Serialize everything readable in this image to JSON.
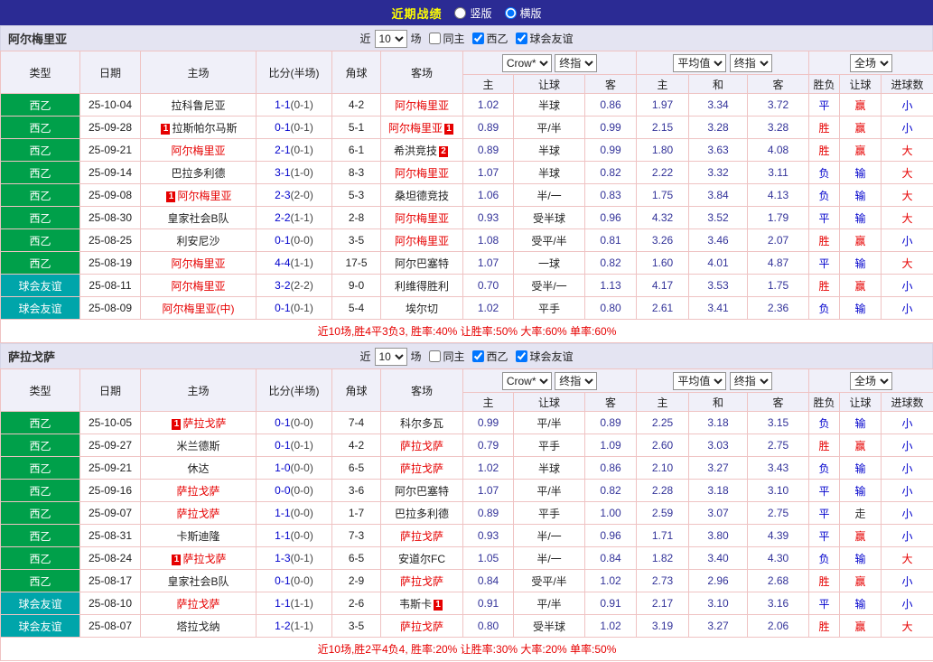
{
  "topbar": {
    "title": "近期战绩",
    "vertical_label": "竖版",
    "horizontal_label": "横版",
    "selected": "横版"
  },
  "filter": {
    "near": "近",
    "count": "10",
    "matches": "场",
    "same_home": "同主",
    "league": "西乙",
    "friendly": "球会友谊",
    "same_home_checked": false,
    "league_checked": true,
    "friendly_checked": true
  },
  "header": {
    "type": "类型",
    "date": "日期",
    "home": "主场",
    "score": "比分(半场)",
    "corner": "角球",
    "away": "客场",
    "odds_source": "Crow*",
    "final1": "终指",
    "average": "平均值",
    "final2": "终指",
    "full": "全场",
    "sub": [
      "主",
      "让球",
      "客",
      "主",
      "和",
      "客",
      "胜负",
      "让球",
      "进球数"
    ]
  },
  "colors": {
    "win": "#E60000",
    "lose": "#0000CC",
    "draw": "#0000CC",
    "walk": "#333333",
    "highlight": "#E60000",
    "league_green": "#00A04A",
    "friendly_teal": "#00A5AA",
    "topbar_bg": "#2B2B94",
    "title_yellow": "#FFFF00",
    "border_pink": "#EFC3C3"
  },
  "sections": [
    {
      "team": "阿尔梅里亚",
      "summary": "近10场,胜4平3负3, 胜率:40% 让胜率:50% 大率:60% 单率:60%",
      "rows": [
        {
          "type": "西乙",
          "kind": "league",
          "date": "25-10-04",
          "home": {
            "name": "拉科鲁尼亚"
          },
          "ft": "1-1",
          "ht": "(0-1)",
          "corner": "4-2",
          "away": {
            "name": "阿尔梅里亚",
            "red": true
          },
          "odds": [
            "1.02",
            "半球",
            "0.86"
          ],
          "avg": [
            "1.97",
            "3.34",
            "3.72"
          ],
          "result": "平",
          "let": "赢",
          "goal": "小"
        },
        {
          "type": "西乙",
          "kind": "league",
          "date": "25-09-28",
          "home": {
            "name": "拉斯帕尔马斯",
            "b1": "1"
          },
          "ft": "0-1",
          "ht": "(0-1)",
          "corner": "5-1",
          "away": {
            "name": "阿尔梅里亚",
            "red": true,
            "b2": "1"
          },
          "odds": [
            "0.89",
            "平/半",
            "0.99"
          ],
          "avg": [
            "2.15",
            "3.28",
            "3.28"
          ],
          "result": "胜",
          "let": "赢",
          "goal": "小"
        },
        {
          "type": "西乙",
          "kind": "league",
          "date": "25-09-21",
          "home": {
            "name": "阿尔梅里亚",
            "red": true
          },
          "ft": "2-1",
          "ht": "(0-1)",
          "corner": "6-1",
          "away": {
            "name": "希洪竞技",
            "b2": "2"
          },
          "odds": [
            "0.89",
            "半球",
            "0.99"
          ],
          "avg": [
            "1.80",
            "3.63",
            "4.08"
          ],
          "result": "胜",
          "let": "赢",
          "goal": "大"
        },
        {
          "type": "西乙",
          "kind": "league",
          "date": "25-09-14",
          "home": {
            "name": "巴拉多利德"
          },
          "ft": "3-1",
          "ht": "(1-0)",
          "corner": "8-3",
          "away": {
            "name": "阿尔梅里亚",
            "red": true
          },
          "odds": [
            "1.07",
            "半球",
            "0.82"
          ],
          "avg": [
            "2.22",
            "3.32",
            "3.11"
          ],
          "result": "负",
          "let": "输",
          "goal": "大"
        },
        {
          "type": "西乙",
          "kind": "league",
          "date": "25-09-08",
          "home": {
            "name": "阿尔梅里亚",
            "red": true,
            "b1": "1"
          },
          "ft": "2-3",
          "ht": "(2-0)",
          "corner": "5-3",
          "away": {
            "name": "桑坦德竞技"
          },
          "odds": [
            "1.06",
            "半/一",
            "0.83"
          ],
          "avg": [
            "1.75",
            "3.84",
            "4.13"
          ],
          "result": "负",
          "let": "输",
          "goal": "大"
        },
        {
          "type": "西乙",
          "kind": "league",
          "date": "25-08-30",
          "home": {
            "name": "皇家社会B队"
          },
          "ft": "2-2",
          "ht": "(1-1)",
          "corner": "2-8",
          "away": {
            "name": "阿尔梅里亚",
            "red": true
          },
          "odds": [
            "0.93",
            "受半球",
            "0.96"
          ],
          "avg": [
            "4.32",
            "3.52",
            "1.79"
          ],
          "result": "平",
          "let": "输",
          "goal": "大"
        },
        {
          "type": "西乙",
          "kind": "league",
          "date": "25-08-25",
          "home": {
            "name": "利安尼沙"
          },
          "ft": "0-1",
          "ht": "(0-0)",
          "corner": "3-5",
          "away": {
            "name": "阿尔梅里亚",
            "red": true
          },
          "odds": [
            "1.08",
            "受平/半",
            "0.81"
          ],
          "avg": [
            "3.26",
            "3.46",
            "2.07"
          ],
          "result": "胜",
          "let": "赢",
          "goal": "小"
        },
        {
          "type": "西乙",
          "kind": "league",
          "date": "25-08-19",
          "home": {
            "name": "阿尔梅里亚",
            "red": true
          },
          "ft": "4-4",
          "ht": "(1-1)",
          "corner": "17-5",
          "away": {
            "name": "阿尔巴塞特"
          },
          "odds": [
            "1.07",
            "一球",
            "0.82"
          ],
          "avg": [
            "1.60",
            "4.01",
            "4.87"
          ],
          "result": "平",
          "let": "输",
          "goal": "大"
        },
        {
          "type": "球会友谊",
          "kind": "friendly",
          "date": "25-08-11",
          "home": {
            "name": "阿尔梅里亚",
            "red": true
          },
          "ft": "3-2",
          "ht": "(2-2)",
          "corner": "9-0",
          "away": {
            "name": "利维得胜利"
          },
          "odds": [
            "0.70",
            "受半/一",
            "1.13"
          ],
          "avg": [
            "4.17",
            "3.53",
            "1.75"
          ],
          "result": "胜",
          "let": "赢",
          "goal": "小"
        },
        {
          "type": "球会友谊",
          "kind": "friendly",
          "date": "25-08-09",
          "home": {
            "name": "阿尔梅里亚(中)",
            "red": true
          },
          "ft": "0-1",
          "ht": "(0-1)",
          "corner": "5-4",
          "away": {
            "name": "埃尔切"
          },
          "odds": [
            "1.02",
            "平手",
            "0.80"
          ],
          "avg": [
            "2.61",
            "3.41",
            "2.36"
          ],
          "result": "负",
          "let": "输",
          "goal": "小"
        }
      ]
    },
    {
      "team": "萨拉戈萨",
      "summary": "近10场,胜2平4负4, 胜率:20% 让胜率:30% 大率:20% 单率:50%",
      "rows": [
        {
          "type": "西乙",
          "kind": "league",
          "date": "25-10-05",
          "home": {
            "name": "萨拉戈萨",
            "red": true,
            "b1": "1"
          },
          "ft": "0-1",
          "ht": "(0-0)",
          "corner": "7-4",
          "away": {
            "name": "科尔多瓦"
          },
          "odds": [
            "0.99",
            "平/半",
            "0.89"
          ],
          "avg": [
            "2.25",
            "3.18",
            "3.15"
          ],
          "result": "负",
          "let": "输",
          "goal": "小"
        },
        {
          "type": "西乙",
          "kind": "league",
          "date": "25-09-27",
          "home": {
            "name": "米兰德斯"
          },
          "ft": "0-1",
          "ht": "(0-1)",
          "corner": "4-2",
          "away": {
            "name": "萨拉戈萨",
            "red": true
          },
          "odds": [
            "0.79",
            "平手",
            "1.09"
          ],
          "avg": [
            "2.60",
            "3.03",
            "2.75"
          ],
          "result": "胜",
          "let": "赢",
          "goal": "小"
        },
        {
          "type": "西乙",
          "kind": "league",
          "date": "25-09-21",
          "home": {
            "name": "休达"
          },
          "ft": "1-0",
          "ht": "(0-0)",
          "corner": "6-5",
          "away": {
            "name": "萨拉戈萨",
            "red": true
          },
          "odds": [
            "1.02",
            "半球",
            "0.86"
          ],
          "avg": [
            "2.10",
            "3.27",
            "3.43"
          ],
          "result": "负",
          "let": "输",
          "goal": "小"
        },
        {
          "type": "西乙",
          "kind": "league",
          "date": "25-09-16",
          "home": {
            "name": "萨拉戈萨",
            "red": true
          },
          "ft": "0-0",
          "ht": "(0-0)",
          "corner": "3-6",
          "away": {
            "name": "阿尔巴塞特"
          },
          "odds": [
            "1.07",
            "平/半",
            "0.82"
          ],
          "avg": [
            "2.28",
            "3.18",
            "3.10"
          ],
          "result": "平",
          "let": "输",
          "goal": "小"
        },
        {
          "type": "西乙",
          "kind": "league",
          "date": "25-09-07",
          "home": {
            "name": "萨拉戈萨",
            "red": true
          },
          "ft": "1-1",
          "ht": "(0-0)",
          "corner": "1-7",
          "away": {
            "name": "巴拉多利德"
          },
          "odds": [
            "0.89",
            "平手",
            "1.00"
          ],
          "avg": [
            "2.59",
            "3.07",
            "2.75"
          ],
          "result": "平",
          "let": "走",
          "goal": "小"
        },
        {
          "type": "西乙",
          "kind": "league",
          "date": "25-08-31",
          "home": {
            "name": "卡斯迪隆"
          },
          "ft": "1-1",
          "ht": "(0-0)",
          "corner": "7-3",
          "away": {
            "name": "萨拉戈萨",
            "red": true
          },
          "odds": [
            "0.93",
            "半/一",
            "0.96"
          ],
          "avg": [
            "1.71",
            "3.80",
            "4.39"
          ],
          "result": "平",
          "let": "赢",
          "goal": "小"
        },
        {
          "type": "西乙",
          "kind": "league",
          "date": "25-08-24",
          "home": {
            "name": "萨拉戈萨",
            "red": true,
            "b1": "1"
          },
          "ft": "1-3",
          "ht": "(0-1)",
          "corner": "6-5",
          "away": {
            "name": "安道尔FC"
          },
          "odds": [
            "1.05",
            "半/一",
            "0.84"
          ],
          "avg": [
            "1.82",
            "3.40",
            "4.30"
          ],
          "result": "负",
          "let": "输",
          "goal": "大"
        },
        {
          "type": "西乙",
          "kind": "league",
          "date": "25-08-17",
          "home": {
            "name": "皇家社会B队"
          },
          "ft": "0-1",
          "ht": "(0-0)",
          "corner": "2-9",
          "away": {
            "name": "萨拉戈萨",
            "red": true
          },
          "odds": [
            "0.84",
            "受平/半",
            "1.02"
          ],
          "avg": [
            "2.73",
            "2.96",
            "2.68"
          ],
          "result": "胜",
          "let": "赢",
          "goal": "小"
        },
        {
          "type": "球会友谊",
          "kind": "friendly",
          "date": "25-08-10",
          "home": {
            "name": "萨拉戈萨",
            "red": true
          },
          "ft": "1-1",
          "ht": "(1-1)",
          "corner": "2-6",
          "away": {
            "name": "韦斯卡",
            "b2": "1"
          },
          "odds": [
            "0.91",
            "平/半",
            "0.91"
          ],
          "avg": [
            "2.17",
            "3.10",
            "3.16"
          ],
          "result": "平",
          "let": "输",
          "goal": "小"
        },
        {
          "type": "球会友谊",
          "kind": "friendly",
          "date": "25-08-07",
          "home": {
            "name": "塔拉戈纳"
          },
          "ft": "1-2",
          "ht": "(1-1)",
          "corner": "3-5",
          "away": {
            "name": "萨拉戈萨",
            "red": true
          },
          "odds": [
            "0.80",
            "受半球",
            "1.02"
          ],
          "avg": [
            "3.19",
            "3.27",
            "2.06"
          ],
          "result": "胜",
          "let": "赢",
          "goal": "大"
        }
      ]
    }
  ]
}
